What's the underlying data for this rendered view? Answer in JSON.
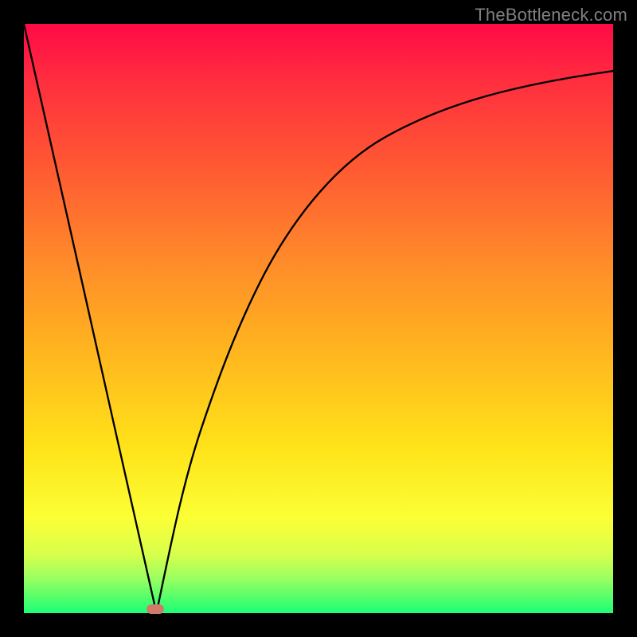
{
  "chart_data": {
    "type": "line",
    "title": "",
    "subtitle": "",
    "xlabel": "",
    "ylabel": "",
    "xlim": [
      0,
      1000
    ],
    "ylim": [
      0,
      1000
    ],
    "watermark": "TheBottleneck.com",
    "background_gradient": {
      "top": "#ff0a47",
      "mid": "#ffe319",
      "bottom": "#1cff77"
    },
    "marker": {
      "x": 225,
      "y": 2,
      "color": "#cf7a6a"
    },
    "series": [
      {
        "name": "bottleneck-curve",
        "segment": "left",
        "x": [
          0,
          50,
          100,
          150,
          200,
          225
        ],
        "y": [
          1000,
          778,
          556,
          333,
          111,
          0
        ]
      },
      {
        "name": "bottleneck-curve",
        "segment": "right",
        "x": [
          225,
          260,
          300,
          340,
          380,
          420,
          480,
          560,
          660,
          780,
          900,
          1000
        ],
        "y": [
          0,
          160,
          310,
          430,
          525,
          600,
          690,
          770,
          835,
          880,
          905,
          920
        ]
      }
    ]
  },
  "watermark_text": "TheBottleneck.com"
}
